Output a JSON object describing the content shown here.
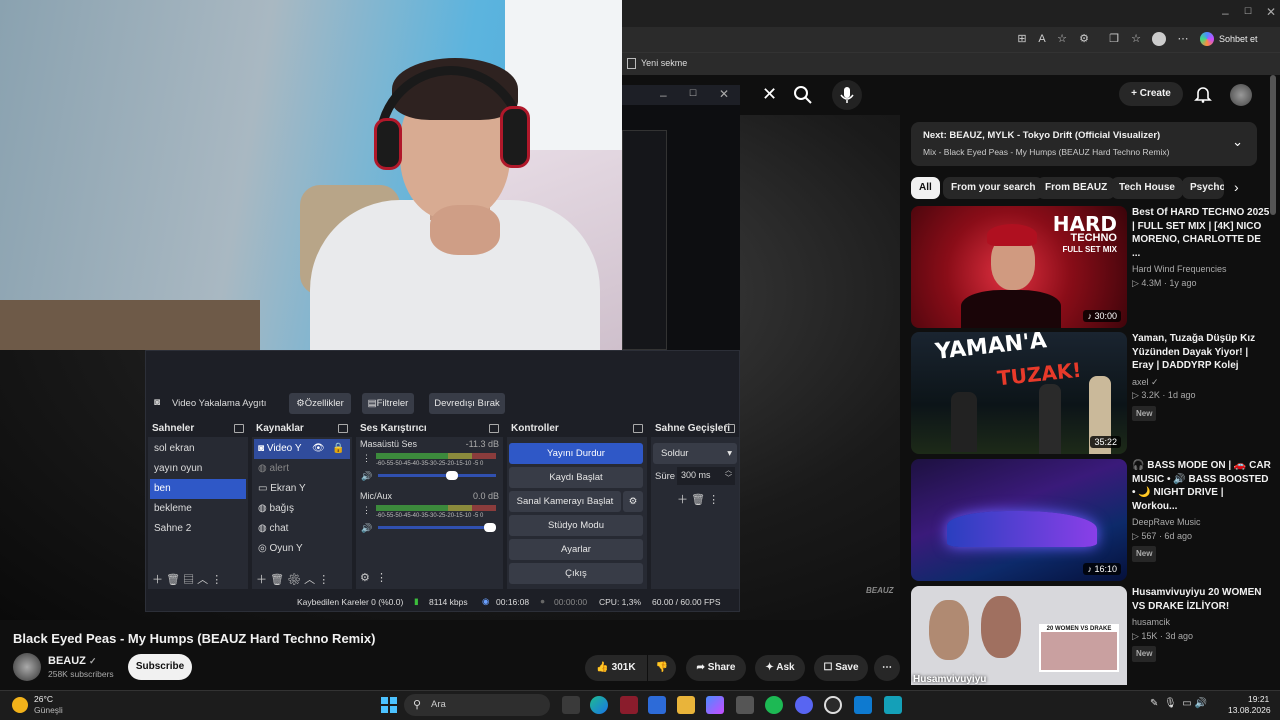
{
  "browser": {
    "chat_label": "Sohbet et",
    "fav_label": "Yeni sekme"
  },
  "obs": {
    "source_label": "Video Yakalama Aygıtı",
    "props_label": "Özellikler",
    "filters_label": "Filtreler",
    "deactivate_label": "Devredışı Bırak",
    "scenes_header": "Sahneler",
    "scenes": [
      "sol ekran",
      "yayın oyun",
      "ben",
      "bekleme",
      "Sahne 2"
    ],
    "sources_header": "Kaynaklar",
    "sources": [
      "Video Y",
      "alert",
      "Ekran Y",
      "bağış",
      "chat",
      "Oyun Y"
    ],
    "mixer_header": "Ses Karıştırıcı",
    "desktop_audio": "Masaüstü Ses",
    "desktop_db": "-11.3 dB",
    "mic_audio": "Mic/Aux",
    "mic_db": "0.0 dB",
    "meter_scale": "-60-55-50-45-40-35-30-25-20-15-10 -5  0",
    "controls_header": "Kontroller",
    "controls": {
      "stop_stream": "Yayını Durdur",
      "start_record": "Kaydı Başlat",
      "virtual_cam": "Sanal Kamerayı Başlat",
      "studio": "Stüdyo Modu",
      "settings": "Ayarlar",
      "exit": "Çıkış"
    },
    "transitions_header": "Sahne Geçişleri",
    "transition": "Soldur",
    "duration_label": "Süre",
    "duration": "300 ms",
    "status": {
      "dropped": "Kaybedilen Kareler 0 (%0.0)",
      "bitrate": "8114 kbps",
      "stream_time": "00:16:08",
      "rec_time": "00:00:00",
      "cpu": "CPU: 1,3%",
      "fps": "60.00 / 60.00 FPS"
    }
  },
  "youtube": {
    "create_label": "Create",
    "next_title": "Next: BEAUZ, MYLK - Tokyo Drift (Official Visualizer)",
    "next_sub": "Mix - Black Eyed Peas - My Humps (BEAUZ Hard Techno Remix)",
    "chips": [
      "All",
      "From your search",
      "From BEAUZ",
      "Tech House",
      "Psycho"
    ],
    "videos": [
      {
        "title": "Best Of HARD TECHNO 2025 | FULL SET MIX | [4K] NICO MORENO, CHARLOTTE DE ...",
        "channel": "Hard Wind Frequencies",
        "meta": "4.3M · 1y ago",
        "duration": "30:00",
        "thumb_text": "HARD",
        "thumb_text2": "TECHNO",
        "thumb_text3": "FULL SET MIX"
      },
      {
        "title": "Yaman, Tuzağa Düşüp Kız Yüzünden Dayak Yiyor! | Eray | DADDYRP Kolej",
        "channel": "axel",
        "meta": "3.2K · 1d ago",
        "badge": "New",
        "duration": "35:22",
        "thumb_text": "YAMAN'A",
        "thumb_text2": "TUZAK!"
      },
      {
        "title": "🎧 BASS MODE ON | 🚗 CAR MUSIC • 🔊 BASS BOOSTED • 🌙 NIGHT DRIVE | Workou...",
        "channel": "DeepRave Music",
        "meta": "567 · 6d ago",
        "badge": "New",
        "duration": "16:10"
      },
      {
        "title": "Husamvivuyiyu 20 WOMEN VS DRAKE İZLİYOR!",
        "channel": "husamcik",
        "meta": "15K · 3d ago",
        "badge": "New",
        "thumb_text": "Husamvivuyiyu",
        "thumb_text2": "20 WOMEN VS DRAKE"
      }
    ],
    "video_title": "Black Eyed Peas - My Humps (BEAUZ Hard Techno Remix)",
    "channel": "BEAUZ",
    "subs": "258K subscribers",
    "subscribe": "Subscribe",
    "likes": "301K",
    "share": "Share",
    "ask": "Ask",
    "save": "Save",
    "watermark": "BEAUZ"
  },
  "taskbar": {
    "temp": "26°C",
    "weather": "Güneşli",
    "search": "Ara",
    "time": "19:21",
    "date": "13.08.2026"
  }
}
